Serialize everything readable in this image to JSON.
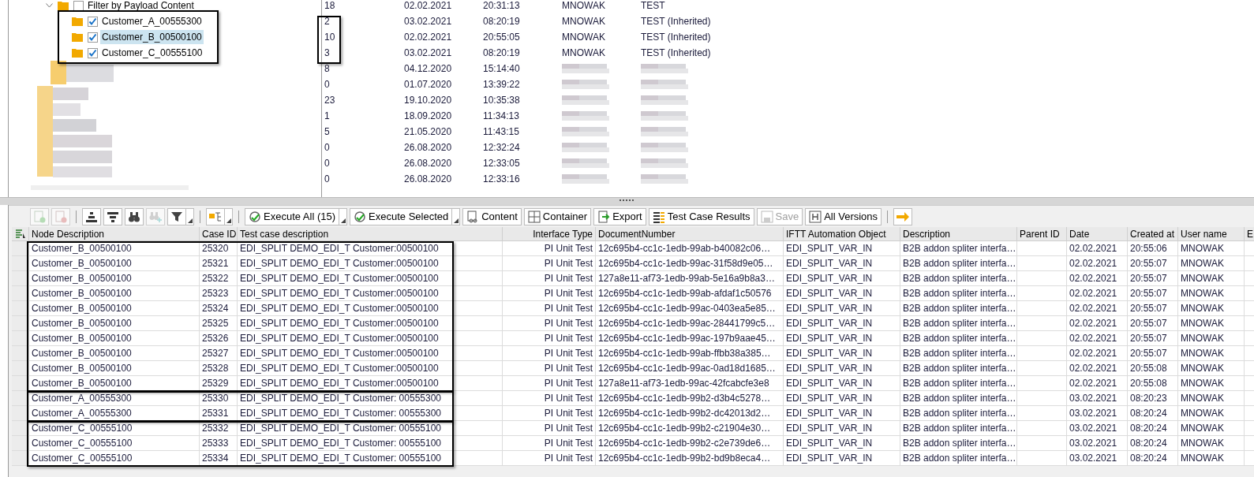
{
  "tree": {
    "items": [
      {
        "label": "Filter by Payload Content",
        "checked": false,
        "expanded": true,
        "selected": false,
        "children": [
          {
            "label": "Customer_A_00555300",
            "checked": true,
            "selected": false
          },
          {
            "label": "Customer_B_00500100",
            "checked": true,
            "selected": true
          },
          {
            "label": "Customer_C_00555100",
            "checked": true,
            "selected": false
          }
        ]
      }
    ]
  },
  "top_list": {
    "rows": [
      {
        "count": "18",
        "date": "02.02.2021",
        "time": "20:31:13",
        "user": "MNOWAK",
        "type": "TEST"
      },
      {
        "count": "2",
        "date": "03.02.2021",
        "time": "08:20:19",
        "user": "MNOWAK",
        "type": "TEST (Inherited)"
      },
      {
        "count": "10",
        "date": "02.02.2021",
        "time": "20:55:05",
        "user": "MNOWAK",
        "type": "TEST (Inherited)"
      },
      {
        "count": "3",
        "date": "03.02.2021",
        "time": "08:20:19",
        "user": "MNOWAK",
        "type": "TEST (Inherited)"
      },
      {
        "count": "8",
        "date": "04.12.2020",
        "time": "15:14:40"
      },
      {
        "count": "0",
        "date": "01.07.2020",
        "time": "13:39:22"
      },
      {
        "count": "23",
        "date": "19.10.2020",
        "time": "10:35:38"
      },
      {
        "count": "1",
        "date": "18.09.2020",
        "time": "11:34:13"
      },
      {
        "count": "5",
        "date": "21.05.2020",
        "time": "11:43:15"
      },
      {
        "count": "0",
        "date": "26.08.2020",
        "time": "12:32:24"
      },
      {
        "count": "0",
        "date": "26.08.2020",
        "time": "12:33:05"
      },
      {
        "count": "0",
        "date": "26.08.2020",
        "time": "12:33:16"
      }
    ]
  },
  "toolbar": {
    "items": [
      {
        "kind": "icon",
        "disabled": true,
        "dropdown": false
      },
      {
        "kind": "icon",
        "disabled": true,
        "dropdown": false
      },
      {
        "kind": "separator"
      },
      {
        "kind": "icon",
        "disabled": false,
        "dropdown": false
      },
      {
        "kind": "icon",
        "disabled": false,
        "dropdown": false
      },
      {
        "kind": "icon",
        "disabled": false,
        "dropdown": false
      },
      {
        "kind": "icon",
        "disabled": true,
        "dropdown": false
      },
      {
        "kind": "icon",
        "disabled": false,
        "dropdown": true
      },
      {
        "kind": "separator"
      },
      {
        "kind": "icon",
        "disabled": false,
        "dropdown": true
      },
      {
        "kind": "separator"
      },
      {
        "kind": "text",
        "label": "Execute All (15)",
        "disabled": false,
        "dropdown": true
      },
      {
        "kind": "text",
        "label": "Execute Selected",
        "disabled": false,
        "dropdown": true
      },
      {
        "kind": "text",
        "label": "Content",
        "disabled": false,
        "dropdown": false
      },
      {
        "kind": "text",
        "label": "Container",
        "disabled": false,
        "dropdown": false
      },
      {
        "kind": "text",
        "label": "Export",
        "disabled": false,
        "dropdown": false
      },
      {
        "kind": "text",
        "label": "Test Case Results",
        "disabled": false,
        "dropdown": false
      },
      {
        "kind": "text",
        "label": "Save",
        "disabled": true,
        "dropdown": false
      },
      {
        "kind": "text",
        "label": "All Versions",
        "disabled": false,
        "dropdown": false
      },
      {
        "kind": "separator"
      },
      {
        "kind": "icon",
        "disabled": false,
        "dropdown": false
      }
    ]
  },
  "table": {
    "columns": [
      "Node Description",
      "Case ID",
      "Test case description",
      "Interface Type",
      "DocumentNumber",
      "IFTT Automation Object",
      "Description",
      "Parent ID",
      "Date",
      "Created at",
      "User name",
      "E"
    ],
    "row_groups": [
      {
        "rows": [
          [
            "Customer_B_00500100",
            "25320",
            "EDI_SPLIT DEMO_EDI_T Customer:00500100",
            "PI Unit Test",
            "12c695b4-cc1c-1edb-99ab-b40082c06…",
            "EDI_SPLIT_VAR_IN",
            "B2B addon spliter interfa…",
            "",
            "02.02.2021",
            "20:55:06",
            "MNOWAK"
          ],
          [
            "Customer_B_00500100",
            "25321",
            "EDI_SPLIT DEMO_EDI_T Customer:00500100",
            "PI Unit Test",
            "12c695b4-cc1c-1edb-99ac-31f58d9e05…",
            "EDI_SPLIT_VAR_IN",
            "B2B addon spliter interfa…",
            "",
            "02.02.2021",
            "20:55:07",
            "MNOWAK"
          ],
          [
            "Customer_B_00500100",
            "25322",
            "EDI_SPLIT DEMO_EDI_T Customer:00500100",
            "PI Unit Test",
            "127a8e11-af73-1edb-99ab-5e16a9b8a3…",
            "EDI_SPLIT_VAR_IN",
            "B2B addon spliter interfa…",
            "",
            "02.02.2021",
            "20:55:07",
            "MNOWAK"
          ],
          [
            "Customer_B_00500100",
            "25323",
            "EDI_SPLIT DEMO_EDI_T Customer:00500100",
            "PI Unit Test",
            "12c695b4-cc1c-1edb-99ab-afdaf1c50576",
            "EDI_SPLIT_VAR_IN",
            "B2B addon spliter interfa…",
            "",
            "02.02.2021",
            "20:55:07",
            "MNOWAK"
          ],
          [
            "Customer_B_00500100",
            "25324",
            "EDI_SPLIT DEMO_EDI_T Customer:00500100",
            "PI Unit Test",
            "12c695b4-cc1c-1edb-99ac-0403ea5e85…",
            "EDI_SPLIT_VAR_IN",
            "B2B addon spliter interfa…",
            "",
            "02.02.2021",
            "20:55:07",
            "MNOWAK"
          ],
          [
            "Customer_B_00500100",
            "25325",
            "EDI_SPLIT DEMO_EDI_T Customer:00500100",
            "PI Unit Test",
            "12c695b4-cc1c-1edb-99ac-28441799c5…",
            "EDI_SPLIT_VAR_IN",
            "B2B addon spliter interfa…",
            "",
            "02.02.2021",
            "20:55:07",
            "MNOWAK"
          ],
          [
            "Customer_B_00500100",
            "25326",
            "EDI_SPLIT DEMO_EDI_T Customer:00500100",
            "PI Unit Test",
            "12c695b4-cc1c-1edb-99ac-197b9aae45…",
            "EDI_SPLIT_VAR_IN",
            "B2B addon spliter interfa…",
            "",
            "02.02.2021",
            "20:55:07",
            "MNOWAK"
          ],
          [
            "Customer_B_00500100",
            "25327",
            "EDI_SPLIT DEMO_EDI_T Customer:00500100",
            "PI Unit Test",
            "12c695b4-cc1c-1edb-99ab-ffbb38a385…",
            "EDI_SPLIT_VAR_IN",
            "B2B addon spliter interfa…",
            "",
            "02.02.2021",
            "20:55:07",
            "MNOWAK"
          ],
          [
            "Customer_B_00500100",
            "25328",
            "EDI_SPLIT DEMO_EDI_T Customer:00500100",
            "PI Unit Test",
            "12c695b4-cc1c-1edb-99ac-0ad18d1685…",
            "EDI_SPLIT_VAR_IN",
            "B2B addon spliter interfa…",
            "",
            "02.02.2021",
            "20:55:08",
            "MNOWAK"
          ],
          [
            "Customer_B_00500100",
            "25329",
            "EDI_SPLIT DEMO_EDI_T Customer:00500100",
            "PI Unit Test",
            "127a8e11-af73-1edb-99ac-42fcabcfe3e8",
            "EDI_SPLIT_VAR_IN",
            "B2B addon spliter interfa…",
            "",
            "02.02.2021",
            "20:55:08",
            "MNOWAK"
          ]
        ]
      },
      {
        "rows": [
          [
            "Customer_A_00555300",
            "25330",
            "EDI_SPLIT DEMO_EDI_T Customer: 00555300",
            "PI Unit Test",
            "12c695b4-cc1c-1edb-99b2-d3b4c5278…",
            "EDI_SPLIT_VAR_IN",
            "B2B addon spliter interfa…",
            "",
            "03.02.2021",
            "08:20:23",
            "MNOWAK"
          ],
          [
            "Customer_A_00555300",
            "25331",
            "EDI_SPLIT DEMO_EDI_T Customer: 00555300",
            "PI Unit Test",
            "12c695b4-cc1c-1edb-99b2-dc42013d2…",
            "EDI_SPLIT_VAR_IN",
            "B2B addon spliter interfa…",
            "",
            "03.02.2021",
            "08:20:24",
            "MNOWAK"
          ]
        ]
      },
      {
        "rows": [
          [
            "Customer_C_00555100",
            "25332",
            "EDI_SPLIT DEMO_EDI_T Customer: 00555100",
            "PI Unit Test",
            "12c695b4-cc1c-1edb-99b2-c21904e30…",
            "EDI_SPLIT_VAR_IN",
            "B2B addon spliter interfa…",
            "",
            "03.02.2021",
            "08:20:24",
            "MNOWAK"
          ],
          [
            "Customer_C_00555100",
            "25333",
            "EDI_SPLIT DEMO_EDI_T Customer: 00555100",
            "PI Unit Test",
            "12c695b4-cc1c-1edb-99b2-c2e739de6…",
            "EDI_SPLIT_VAR_IN",
            "B2B addon spliter interfa…",
            "",
            "03.02.2021",
            "08:20:24",
            "MNOWAK"
          ],
          [
            "Customer_C_00555100",
            "25334",
            "EDI_SPLIT DEMO_EDI_T Customer: 00555100",
            "PI Unit Test",
            "12c695b4-cc1c-1edb-99b2-bd9b8eca4…",
            "EDI_SPLIT_VAR_IN",
            "B2B addon spliter interfa…",
            "",
            "03.02.2021",
            "08:20:24",
            "MNOWAK"
          ]
        ]
      }
    ]
  }
}
